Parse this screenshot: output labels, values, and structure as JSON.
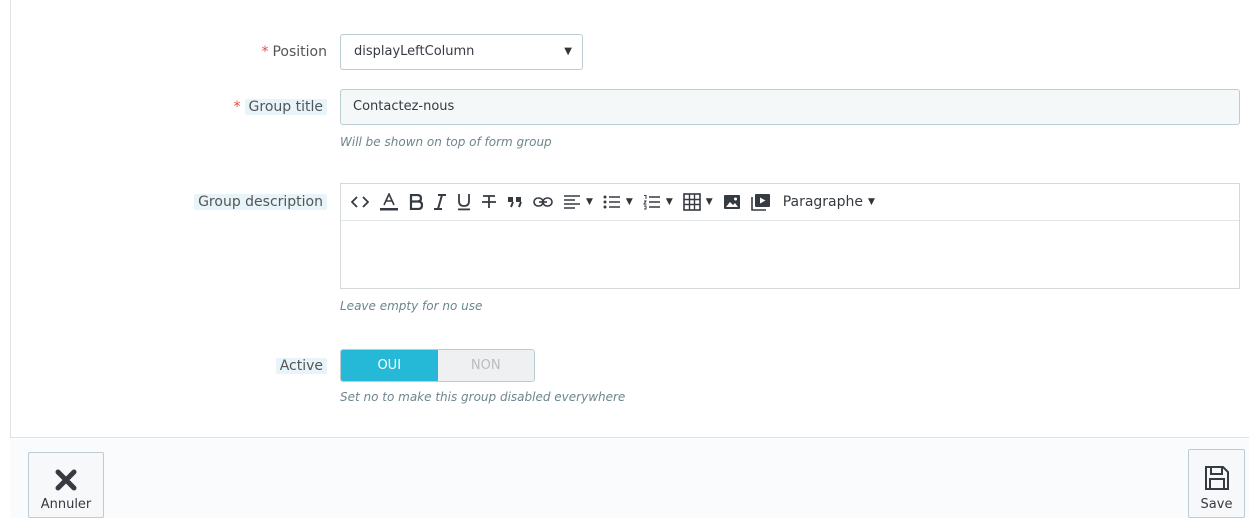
{
  "form": {
    "position": {
      "required_mark": "*",
      "label": "Position",
      "value": "displayLeftColumn",
      "caret": "▼"
    },
    "group_title": {
      "required_mark": "*",
      "label": "Group title",
      "value": "Contactez-nous",
      "help": "Will be shown on top of form group"
    },
    "group_description": {
      "label": "Group description",
      "help": "Leave empty for no use",
      "toolbar": {
        "format_label": "Paragraphe"
      }
    },
    "active": {
      "label": "Active",
      "on_label": "OUI",
      "off_label": "NON",
      "help": "Set no to make this group disabled everywhere",
      "value": "OUI"
    }
  },
  "footer": {
    "cancel_label": "Annuler",
    "save_label": "Save"
  },
  "colors": {
    "accent": "#25b9d7",
    "required": "#e74c3c",
    "label_highlight": "#e7f4fa"
  }
}
